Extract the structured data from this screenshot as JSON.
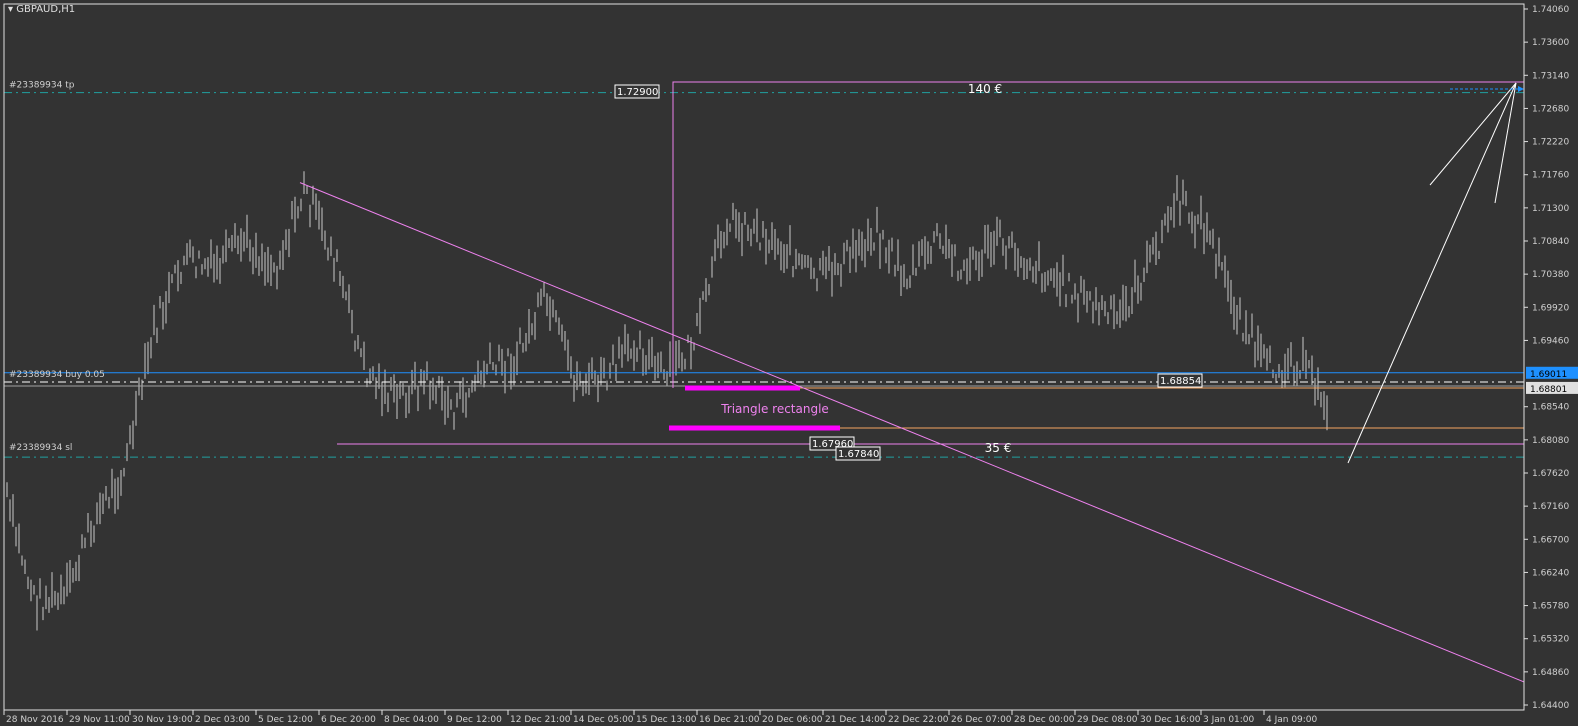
{
  "window": {
    "title": "GBPAUD,H1"
  },
  "colors": {
    "background": "#333333",
    "bars": "#c8c8c8",
    "trendline": "#ee82ee",
    "tp_sl": "#20a0a0",
    "buy_line": "#ffffff",
    "bid": "#a0a0a0",
    "blue_level": "#1e90ff",
    "orange": "#f4a460",
    "magenta": "#ff00ff"
  },
  "chart_data": {
    "type": "bar",
    "symbol": "GBPAUD",
    "timeframe": "H1",
    "ylim": [
      1.644,
      1.7406
    ],
    "yticks": [
      "1.74060",
      "1.73600",
      "1.73140",
      "1.72680",
      "1.72220",
      "1.71760",
      "1.71300",
      "1.70840",
      "1.70380",
      "1.69920",
      "1.69460",
      "1.69011",
      "1.68801",
      "1.68540",
      "1.68080",
      "1.67620",
      "1.67160",
      "1.66700",
      "1.66240",
      "1.65780",
      "1.65320",
      "1.64860",
      "1.64400"
    ],
    "xticks": [
      "28 Nov 2016",
      "29 Nov 11:00",
      "30 Nov 19:00",
      "2 Dec 03:00",
      "5 Dec 12:00",
      "6 Dec 20:00",
      "8 Dec 04:00",
      "9 Dec 12:00",
      "12 Dec 21:00",
      "14 Dec 05:00",
      "15 Dec 13:00",
      "16 Dec 21:00",
      "20 Dec 06:00",
      "21 Dec 14:00",
      "22 Dec 22:00",
      "26 Dec 07:00",
      "28 Dec 00:00",
      "29 Dec 08:00",
      "30 Dec 16:00",
      "3 Jan 01:00",
      "4 Jan 09:00"
    ],
    "price_path": [
      1.6738,
      1.6586,
      1.6586,
      1.6697,
      1.6766,
      1.6961,
      1.7058,
      1.7044,
      1.7085,
      1.7044,
      1.7155,
      1.7058,
      1.6905,
      1.6863,
      1.6891,
      1.6849,
      1.6905,
      1.6919,
      1.7002,
      1.6891,
      1.6891,
      1.6947,
      1.6891,
      1.6947,
      1.7113,
      1.7099,
      1.7072,
      1.703,
      1.7058,
      1.7099,
      1.703,
      1.7085,
      1.7044,
      1.7085,
      1.7058,
      1.703,
      1.7002,
      1.6974,
      1.7044,
      1.7141,
      1.7099,
      1.6988,
      1.6905,
      1.6919,
      1.6863
    ],
    "levels": {
      "tp": {
        "label": "#23389934 tp",
        "price": 1.729,
        "price_label": "1.72900"
      },
      "buy": {
        "label": "#23389934 buy 0.05",
        "price": 1.68854,
        "price_label": "1.68854"
      },
      "sl": {
        "label": "#23389934 sl",
        "price": 1.6784,
        "price_label": "1.67840"
      },
      "blue": {
        "price": 1.69011,
        "price_label": "1.69011"
      },
      "bid": {
        "price": 1.68801,
        "price_label": "1.68801"
      },
      "support": {
        "price": 1.6796,
        "price_label": "1.67960"
      },
      "orange_upper": 1.6878,
      "orange_lower": 1.6822,
      "top_box": 1.7314
    },
    "trendline": {
      "from_price": 1.7165,
      "to_price": 1.6472
    },
    "annotations": {
      "triangle": "Triangle rectangle",
      "profit": "140 €",
      "loss": "35 €"
    }
  }
}
